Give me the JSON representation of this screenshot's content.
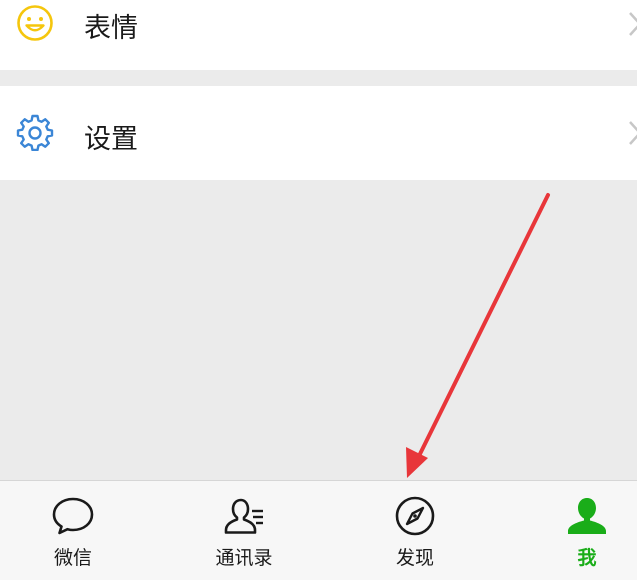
{
  "menu": {
    "emoji": {
      "label": "表情",
      "icon": "smiley-icon",
      "icon_color": "#f5c60d"
    },
    "settings": {
      "label": "设置",
      "icon": "gear-icon",
      "icon_color": "#3b86d6"
    }
  },
  "tabbar": {
    "tabs": [
      {
        "label": "微信",
        "icon": "chat-bubble-icon"
      },
      {
        "label": "通讯录",
        "icon": "contacts-icon"
      },
      {
        "label": "发现",
        "icon": "compass-icon"
      },
      {
        "label": "我",
        "icon": "person-icon",
        "active": true
      }
    ],
    "active_color": "#1aad19",
    "inactive_color": "#1a1a1a"
  },
  "annotation": {
    "type": "red-arrow",
    "color": "#e8363a",
    "points_to": "发现"
  }
}
